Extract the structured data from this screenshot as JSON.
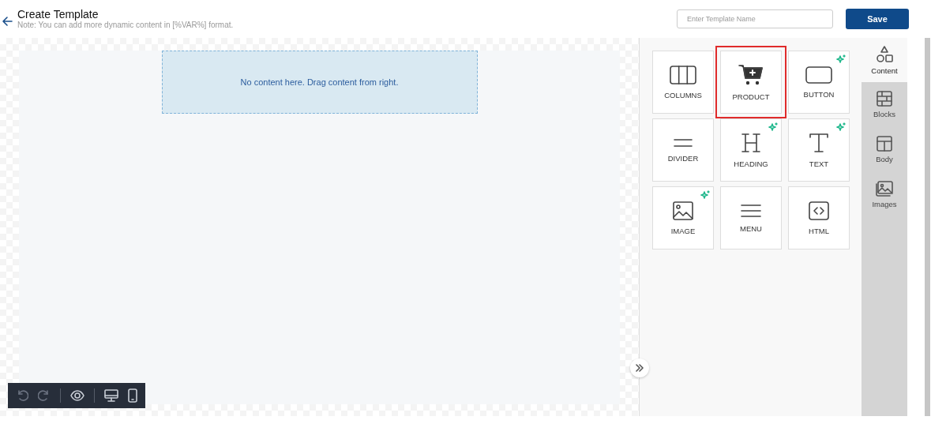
{
  "header": {
    "title": "Create Template",
    "note": "Note: You can add more dynamic content in [%VAR%] format.",
    "name_field": {
      "placeholder": "Enter Template Name"
    },
    "save": "Save"
  },
  "canvas": {
    "dropzone": "No content here. Drag content from right."
  },
  "blocks": [
    {
      "label": "COLUMNS",
      "kind": "columns",
      "selected": false,
      "ai": false
    },
    {
      "label": "PRODUCT",
      "kind": "product",
      "selected": true,
      "ai": false
    },
    {
      "label": "BUTTON",
      "kind": "button",
      "selected": false,
      "ai": true
    },
    {
      "label": "DIVIDER",
      "kind": "divider",
      "selected": false,
      "ai": false
    },
    {
      "label": "HEADING",
      "kind": "heading",
      "selected": false,
      "ai": true
    },
    {
      "label": "TEXT",
      "kind": "text",
      "selected": false,
      "ai": true
    },
    {
      "label": "IMAGE",
      "kind": "image",
      "selected": false,
      "ai": true
    },
    {
      "label": "MENU",
      "kind": "menu",
      "selected": false,
      "ai": false
    },
    {
      "label": "HTML",
      "kind": "html",
      "selected": false,
      "ai": false
    }
  ],
  "tabs": [
    {
      "label": "Content",
      "kind": "content",
      "selected": true
    },
    {
      "label": "Blocks",
      "kind": "blocks",
      "selected": false
    },
    {
      "label": "Body",
      "kind": "body",
      "selected": false
    },
    {
      "label": "Images",
      "kind": "images",
      "selected": false
    }
  ],
  "toolbar": [
    {
      "kind": "undo",
      "disabled": true
    },
    {
      "kind": "redo",
      "disabled": true
    },
    {
      "kind": "preview",
      "disabled": false
    },
    {
      "kind": "desktop",
      "disabled": false
    },
    {
      "kind": "mobile",
      "disabled": false
    }
  ]
}
